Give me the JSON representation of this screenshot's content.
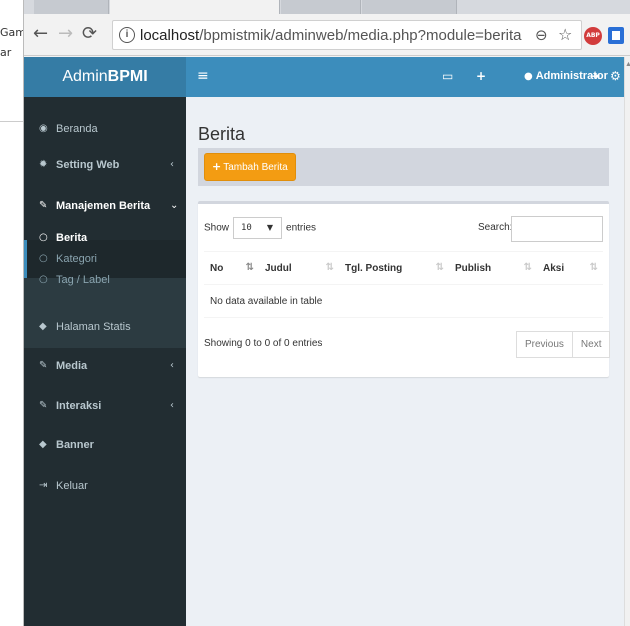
{
  "left_window": {
    "text1": "Gam",
    "text2": "ar"
  },
  "browser": {
    "back_icon": "arrow-left-icon",
    "forward_icon": "arrow-right-icon",
    "reload_icon": "reload-icon",
    "url_host": "localhost",
    "url_path": "/bpmistmik/adminweb/media.php?module=berita",
    "extension_abp_label": "ABP"
  },
  "header": {
    "logo_prefix": "Admin",
    "logo_bold": "BPMI",
    "user_name": "Administrator",
    "colors": {
      "logo_bg": "#357ca5",
      "bar_bg": "#3c8dbc"
    }
  },
  "sidebar": {
    "items": [
      {
        "icon": "dashboard-icon",
        "label": "Beranda"
      },
      {
        "icon": "gear-icon",
        "label": "Setting Web",
        "chevron": "‹"
      },
      {
        "icon": "edit-icon",
        "label": "Manajemen Berita",
        "chevron": "⌄"
      },
      {
        "icon": "tag-icon",
        "label": "Halaman Statis"
      },
      {
        "icon": "edit-icon",
        "label": "Media",
        "chevron": "‹"
      },
      {
        "icon": "edit-icon",
        "label": "Interaksi",
        "chevron": "‹"
      },
      {
        "icon": "tag-icon",
        "label": "Banner"
      },
      {
        "icon": "sign-out-icon",
        "label": "Keluar"
      }
    ],
    "sub_items": [
      {
        "label": "Berita",
        "current": true
      },
      {
        "label": "Kategori"
      },
      {
        "label": "Tag / Label"
      }
    ],
    "colors": {
      "bg": "#222d32",
      "text": "#b8c7ce"
    }
  },
  "main": {
    "title": "Berita",
    "add_button_label": "Tambah Berita",
    "add_button_color": "#f39c12",
    "show_label": "Show",
    "entries_value": "10",
    "entries_label": "entries",
    "search_label": "Search:",
    "search_value": "",
    "columns": [
      "No",
      "Judul",
      "Tgl. Posting",
      "Publish",
      "Aksi"
    ],
    "empty_message": "No data available in table",
    "info": "Showing 0 to 0 of 0 entries",
    "prev_label": "Previous",
    "next_label": "Next"
  }
}
